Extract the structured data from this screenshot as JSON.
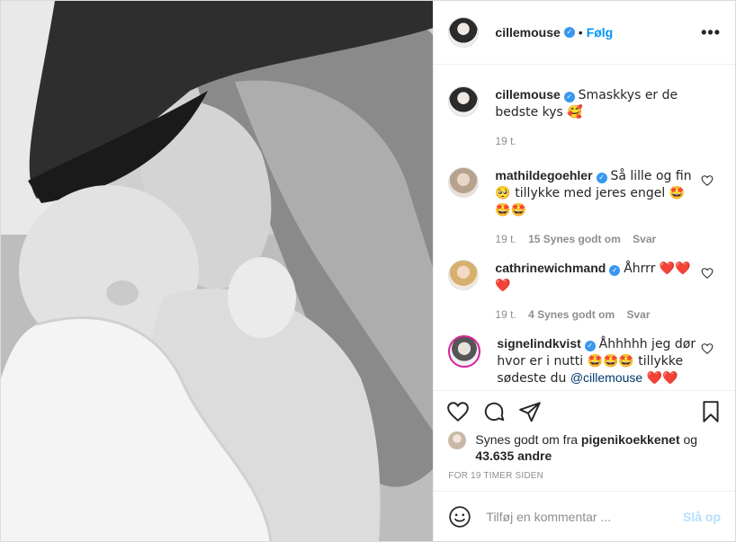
{
  "header": {
    "username": "cillemouse",
    "follow_label": "Følg",
    "separator": "•",
    "more_label": "•••"
  },
  "comments": [
    {
      "username": "cillemouse",
      "text": "Smaskkys er de bedste kys 🥰",
      "time": "19 t."
    },
    {
      "username": "mathildegoehler",
      "text": "Så lille og fin 🥺 tillykke med jeres engel 🤩🤩🤩",
      "time": "19 t.",
      "likes": "15 Synes godt om",
      "reply": "Svar"
    },
    {
      "username": "cathrinewichmand",
      "text": "Åhrrr ❤️❤️❤️",
      "time": "19 t.",
      "likes": "4 Synes godt om",
      "reply": "Svar"
    },
    {
      "username": "signelindkvist",
      "text_before": "Åhhhhh jeg dør hvor er i nutti 🤩🤩🤩 tillykke sødeste du ",
      "mention": "@cillemouse",
      "text_after": " ❤️❤️"
    }
  ],
  "likes_line": {
    "prefix": "Synes godt om fra ",
    "user": "pigenikoekkenet",
    "middle": " og ",
    "count": "43.635 andre"
  },
  "timestamp": "FOR 19 TIMER SIDEN",
  "add_comment": {
    "placeholder": "Tilføj en kommentar ...",
    "post_label": "Slå op"
  },
  "icons": {
    "like": "heart-icon",
    "comment": "comment-icon",
    "share": "share-icon",
    "save": "bookmark-icon",
    "emoji": "emoji-icon",
    "verified": "verified-badge-icon"
  },
  "colors": {
    "link_blue": "#0095f6",
    "post_disabled": "#b2dffc",
    "verified": "#3897f0",
    "heart_red": "#ed4956"
  }
}
